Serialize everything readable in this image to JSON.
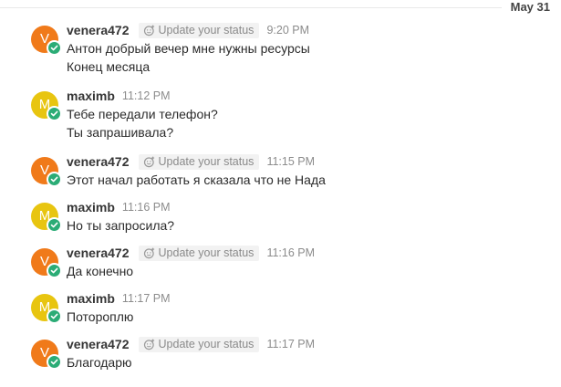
{
  "date_divider": "May 31",
  "status_placeholder": "Update your status",
  "users": {
    "venera": {
      "initial": "V",
      "color": "#f07a1a"
    },
    "maxim": {
      "initial": "M",
      "color": "#e8c510"
    }
  },
  "messages": [
    {
      "user": "venera472",
      "avatar_initial": "V",
      "has_status": true,
      "time": "9:20 PM",
      "lines": [
        "Антон добрый вечер мне нужны ресурсы",
        "Конец месяца"
      ]
    },
    {
      "user": "maximb",
      "avatar_initial": "M",
      "has_status": false,
      "time": "11:12 PM",
      "lines": [
        "Тебе передали телефон?",
        "Ты запрашивала?"
      ]
    },
    {
      "user": "venera472",
      "avatar_initial": "V",
      "has_status": true,
      "time": "11:15 PM",
      "lines": [
        "Этот начал работать я сказала что не Нада"
      ]
    },
    {
      "user": "maximb",
      "avatar_initial": "M",
      "has_status": false,
      "time": "11:16 PM",
      "lines": [
        "Но ты запросила?"
      ]
    },
    {
      "user": "venera472",
      "avatar_initial": "V",
      "has_status": true,
      "time": "11:16 PM",
      "lines": [
        "Да конечно"
      ]
    },
    {
      "user": "maximb",
      "avatar_initial": "M",
      "has_status": false,
      "time": "11:17 PM",
      "lines": [
        "Потороплю"
      ]
    },
    {
      "user": "venera472",
      "avatar_initial": "V",
      "has_status": true,
      "time": "11:17 PM",
      "lines": [
        "Благодарю"
      ]
    }
  ]
}
